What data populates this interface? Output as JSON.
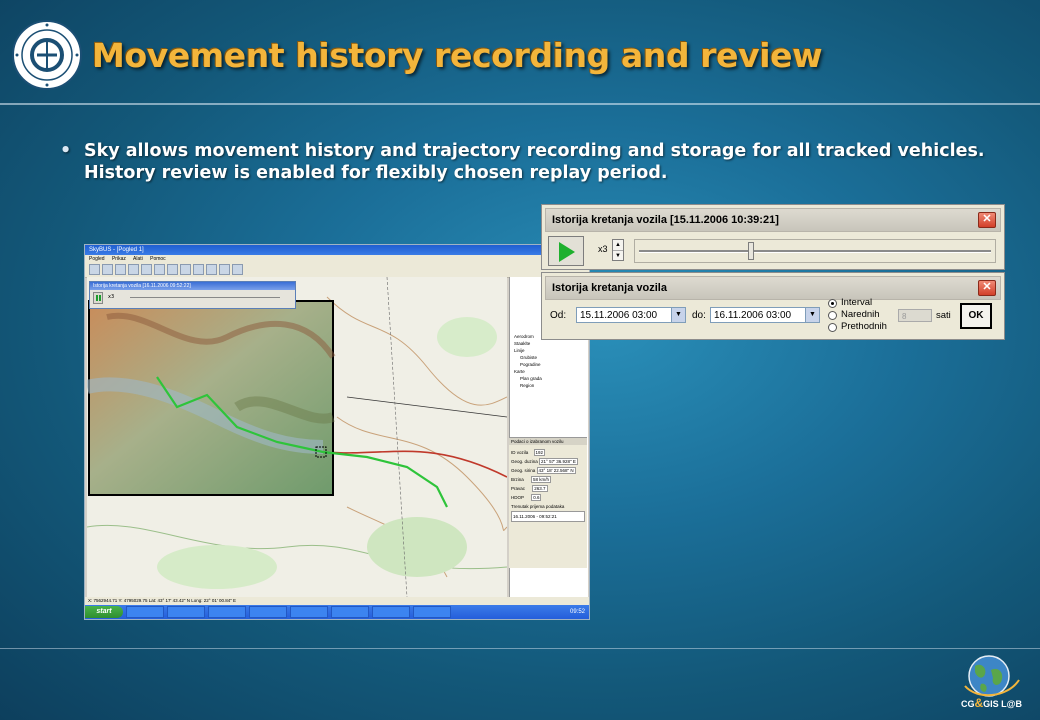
{
  "slide": {
    "title": "Movement history recording and review",
    "bullet_line1": "Sky allows movement history and trajectory recording and storage for all tracked vehicles.",
    "bullet_line2": "History review is enabled for flexibly chosen replay period."
  },
  "dialog_playback": {
    "title": "Istorija kretanja vozila [15.11.2006 10:39:21]",
    "speed": "x3",
    "slider_position": 0.32
  },
  "dialog_interval": {
    "title": "Istorija kretanja vozila",
    "od_label": "Od:",
    "od_value": "15.11.2006 03:00",
    "do_label": "do:",
    "do_value": "16.11.2006 03:00",
    "options": [
      "Interval",
      "Narednih",
      "Prethodnih"
    ],
    "selected_option": "Interval",
    "hours_value": "8",
    "hours_unit": "sati",
    "ok_label": "OK"
  },
  "app_screenshot": {
    "window_title": "SkyBUS - [Pogled 1]",
    "menu": [
      "Pogled",
      "Prikaz",
      "Alati",
      "Pomoc"
    ],
    "mini_dialog_title": "Istorija kretanja vozila [16.11.2006 09:52:22]",
    "mini_speed": "x3",
    "layers": [
      "Aerodrom",
      "Staaklte",
      "Linije",
      "Grubiste",
      "Pogradine",
      "Karte",
      "Plan grada",
      "Region"
    ],
    "vehicle_panel_title": "Podaci o izabranom vozilu",
    "vehicle_fields": [
      {
        "label": "ID vozila",
        "value": "192"
      },
      {
        "label": "Geog. duzina",
        "value": "21° 57' 36.928\" E"
      },
      {
        "label": "Geog. sirina",
        "value": "43° 18' 22.568\" N"
      },
      {
        "label": "Brzina",
        "value": "58 km/h"
      },
      {
        "label": "Pravac",
        "value": "263.7"
      },
      {
        "label": "HDOP",
        "value": "0.6"
      }
    ],
    "timestamp_label": "Trenutak prijema podataka",
    "timestamp_value": "16.11.2006 - 09:52:21",
    "status_text": "X: 7562944.71  Y: 4795029.75  Lat: 43° 17' 43.42\" N  Long: 22° 01' 00.84\" E",
    "start_label": "start",
    "clock": "09:52"
  },
  "logo": {
    "lab_text_left": "CG",
    "lab_amp": "&",
    "lab_text_right": "GIS L@B"
  }
}
